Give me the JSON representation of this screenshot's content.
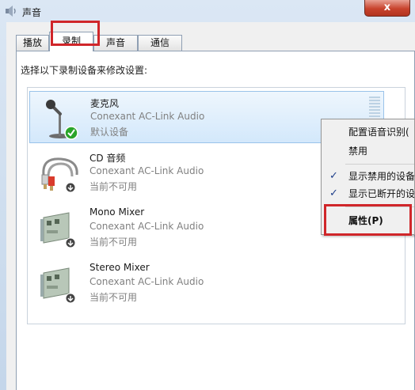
{
  "window": {
    "title": "声音",
    "close_label": "x"
  },
  "tabs": [
    {
      "label": "播放"
    },
    {
      "label": "录制"
    },
    {
      "label": "声音"
    },
    {
      "label": "通信"
    }
  ],
  "instruction": "选择以下录制设备来修改设置:",
  "devices": [
    {
      "name": "麦克风",
      "driver": "Conexant AC-Link Audio",
      "status": "默认设备",
      "icon": "microphone-icon"
    },
    {
      "name": "CD 音频",
      "driver": "Conexant AC-Link Audio",
      "status": "当前不可用",
      "icon": "audio-cable-icon"
    },
    {
      "name": "Mono Mixer",
      "driver": "Conexant AC-Link Audio",
      "status": "当前不可用",
      "icon": "sound-card-icon"
    },
    {
      "name": "Stereo Mixer",
      "driver": "Conexant AC-Link Audio",
      "status": "当前不可用",
      "icon": "sound-card-icon"
    }
  ],
  "context_menu": {
    "items": [
      {
        "label": "配置语音识别(",
        "checked": false
      },
      {
        "label": "禁用",
        "checked": false
      },
      {
        "label": "显示禁用的设备",
        "checked": true
      },
      {
        "label": "显示已断开的设",
        "checked": true
      },
      {
        "label": "属性(P)",
        "checked": false
      }
    ],
    "check_glyph": "✓"
  },
  "colors": {
    "highlight_box": "#d0262a",
    "selected_row": "#d3e8fb",
    "default_badge": "#2aa52a"
  }
}
